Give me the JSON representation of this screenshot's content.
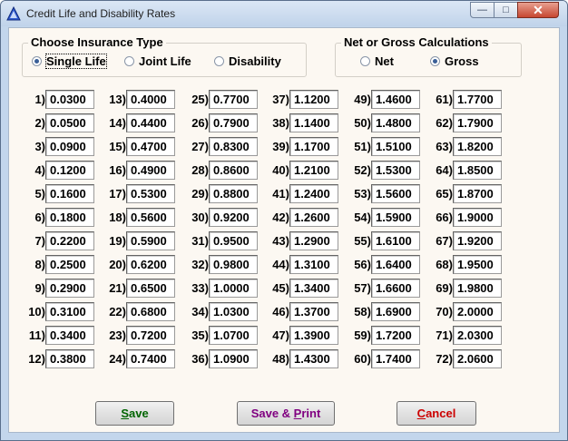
{
  "window": {
    "title": "Credit Life and Disability Rates",
    "controls": {
      "minimize": "—",
      "maximize": "□",
      "close": "✕"
    }
  },
  "insurance_type": {
    "title": "Choose Insurance Type",
    "options": [
      {
        "label": "Single Life",
        "selected": true
      },
      {
        "label": "Joint Life",
        "selected": false
      },
      {
        "label": "Disability",
        "selected": false
      }
    ]
  },
  "calc_type": {
    "title": "Net or Gross Calculations",
    "options": [
      {
        "label": "Net",
        "selected": false
      },
      {
        "label": "Gross",
        "selected": true
      }
    ]
  },
  "rates": [
    [
      {
        "label": "1)",
        "value": "0.0300"
      },
      {
        "label": "2)",
        "value": "0.0500"
      },
      {
        "label": "3)",
        "value": "0.0900"
      },
      {
        "label": "4)",
        "value": "0.1200"
      },
      {
        "label": "5)",
        "value": "0.1600"
      },
      {
        "label": "6)",
        "value": "0.1800"
      },
      {
        "label": "7)",
        "value": "0.2200"
      },
      {
        "label": "8)",
        "value": "0.2500"
      },
      {
        "label": "9)",
        "value": "0.2900"
      },
      {
        "label": "10)",
        "value": "0.3100"
      },
      {
        "label": "11)",
        "value": "0.3400"
      },
      {
        "label": "12)",
        "value": "0.3800"
      }
    ],
    [
      {
        "label": "13)",
        "value": "0.4000"
      },
      {
        "label": "14)",
        "value": "0.4400"
      },
      {
        "label": "15)",
        "value": "0.4700"
      },
      {
        "label": "16)",
        "value": "0.4900"
      },
      {
        "label": "17)",
        "value": "0.5300"
      },
      {
        "label": "18)",
        "value": "0.5600"
      },
      {
        "label": "19)",
        "value": "0.5900"
      },
      {
        "label": "20)",
        "value": "0.6200"
      },
      {
        "label": "21)",
        "value": "0.6500"
      },
      {
        "label": "22)",
        "value": "0.6800"
      },
      {
        "label": "23)",
        "value": "0.7200"
      },
      {
        "label": "24)",
        "value": "0.7400"
      }
    ],
    [
      {
        "label": "25)",
        "value": "0.7700"
      },
      {
        "label": "26)",
        "value": "0.7900"
      },
      {
        "label": "27)",
        "value": "0.8300"
      },
      {
        "label": "28)",
        "value": "0.8600"
      },
      {
        "label": "29)",
        "value": "0.8800"
      },
      {
        "label": "30)",
        "value": "0.9200"
      },
      {
        "label": "31)",
        "value": "0.9500"
      },
      {
        "label": "32)",
        "value": "0.9800"
      },
      {
        "label": "33)",
        "value": "1.0000"
      },
      {
        "label": "34)",
        "value": "1.0300"
      },
      {
        "label": "35)",
        "value": "1.0700"
      },
      {
        "label": "36)",
        "value": "1.0900"
      }
    ],
    [
      {
        "label": "37)",
        "value": "1.1200"
      },
      {
        "label": "38)",
        "value": "1.1400"
      },
      {
        "label": "39)",
        "value": "1.1700"
      },
      {
        "label": "40)",
        "value": "1.2100"
      },
      {
        "label": "41)",
        "value": "1.2400"
      },
      {
        "label": "42)",
        "value": "1.2600"
      },
      {
        "label": "43)",
        "value": "1.2900"
      },
      {
        "label": "44)",
        "value": "1.3100"
      },
      {
        "label": "45)",
        "value": "1.3400"
      },
      {
        "label": "46)",
        "value": "1.3700"
      },
      {
        "label": "47)",
        "value": "1.3900"
      },
      {
        "label": "48)",
        "value": "1.4300"
      }
    ],
    [
      {
        "label": "49)",
        "value": "1.4600"
      },
      {
        "label": "50)",
        "value": "1.4800"
      },
      {
        "label": "51)",
        "value": "1.5100"
      },
      {
        "label": "52)",
        "value": "1.5300"
      },
      {
        "label": "53)",
        "value": "1.5600"
      },
      {
        "label": "54)",
        "value": "1.5900"
      },
      {
        "label": "55)",
        "value": "1.6100"
      },
      {
        "label": "56)",
        "value": "1.6400"
      },
      {
        "label": "57)",
        "value": "1.6600"
      },
      {
        "label": "58)",
        "value": "1.6900"
      },
      {
        "label": "59)",
        "value": "1.7200"
      },
      {
        "label": "60)",
        "value": "1.7400"
      }
    ],
    [
      {
        "label": "61)",
        "value": "1.7700"
      },
      {
        "label": "62)",
        "value": "1.7900"
      },
      {
        "label": "63)",
        "value": "1.8200"
      },
      {
        "label": "64)",
        "value": "1.8500"
      },
      {
        "label": "65)",
        "value": "1.8700"
      },
      {
        "label": "66)",
        "value": "1.9000"
      },
      {
        "label": "67)",
        "value": "1.9200"
      },
      {
        "label": "68)",
        "value": "1.9500"
      },
      {
        "label": "69)",
        "value": "1.9800"
      },
      {
        "label": "70)",
        "value": "2.0000"
      },
      {
        "label": "71)",
        "value": "2.0300"
      },
      {
        "label": "72)",
        "value": "2.0600"
      }
    ]
  ],
  "buttons": {
    "save": {
      "first": "S",
      "rest": "ave",
      "color": "#006400"
    },
    "save_print": {
      "before": "Save & ",
      "key": "P",
      "after": "rint",
      "color": "#800080"
    },
    "cancel": {
      "first": "C",
      "rest": "ancel",
      "color": "#cc0000"
    }
  },
  "colors": {
    "accent": "#3a5f97",
    "client_bg": "#fcf8f2"
  }
}
